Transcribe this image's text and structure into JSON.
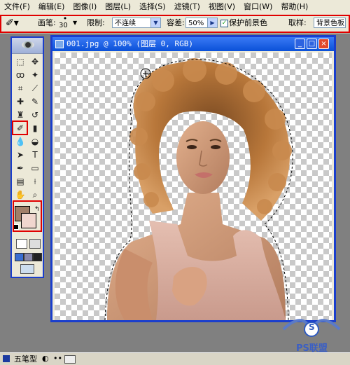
{
  "menu": [
    "文件(F)",
    "编辑(E)",
    "图像(I)",
    "图层(L)",
    "选择(S)",
    "滤镜(T)",
    "视图(V)",
    "窗口(W)",
    "帮助(H)"
  ],
  "options": {
    "brush_label": "画笔:",
    "brush_size": "30",
    "limit_label": "限制:",
    "limit_value": "不连续",
    "tolerance_label": "容差:",
    "tolerance_value": "50%",
    "protect_label": "保护前景色",
    "protect_checked": true,
    "sampling_label": "取样:",
    "sampling_value": "背景色板"
  },
  "document": {
    "title": "001.jpg @ 100% (图层 0, RGB)",
    "min_glyph": "_",
    "max_glyph": "□",
    "close_glyph": "×"
  },
  "colors": {
    "foreground": "#a17f69",
    "background": "#f0d6ce",
    "highlight": "#e00000",
    "window_border": "#1a3ecc"
  },
  "taskbar": {
    "text": "五笔型"
  },
  "watermark": {
    "line1": "S",
    "line2": "PS联盟"
  },
  "tools": [
    {
      "name": "marquee-tool",
      "glyph": "⬚"
    },
    {
      "name": "move-tool",
      "glyph": "✥"
    },
    {
      "name": "lasso-tool",
      "glyph": "ꝏ"
    },
    {
      "name": "magic-wand-tool",
      "glyph": "✦"
    },
    {
      "name": "crop-tool",
      "glyph": "⌗"
    },
    {
      "name": "slice-tool",
      "glyph": "⟋"
    },
    {
      "name": "healing-brush-tool",
      "glyph": "✚"
    },
    {
      "name": "brush-tool",
      "glyph": "✎"
    },
    {
      "name": "clone-stamp-tool",
      "glyph": "♜"
    },
    {
      "name": "history-brush-tool",
      "glyph": "↺"
    },
    {
      "name": "background-eraser-tool",
      "glyph": "✐"
    },
    {
      "name": "gradient-tool",
      "glyph": "▮"
    },
    {
      "name": "blur-tool",
      "glyph": "💧"
    },
    {
      "name": "dodge-tool",
      "glyph": "◒"
    },
    {
      "name": "path-selection-tool",
      "glyph": "➤"
    },
    {
      "name": "type-tool",
      "glyph": "T"
    },
    {
      "name": "pen-tool",
      "glyph": "✒"
    },
    {
      "name": "shape-tool",
      "glyph": "▭"
    },
    {
      "name": "notes-tool",
      "glyph": "▤"
    },
    {
      "name": "eyedropper-tool",
      "glyph": "⟊"
    },
    {
      "name": "hand-tool",
      "glyph": "✋"
    },
    {
      "name": "zoom-tool",
      "glyph": "⌕"
    }
  ]
}
